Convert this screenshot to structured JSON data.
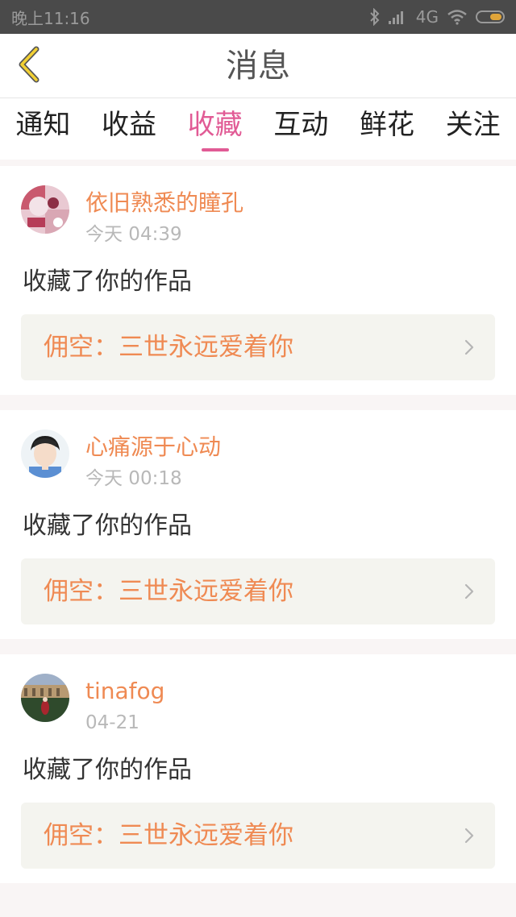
{
  "status_bar": {
    "time": "晚上11:16",
    "network": "4G"
  },
  "header": {
    "title": "消息"
  },
  "tabs": [
    {
      "label": "通知",
      "active": false
    },
    {
      "label": "收益",
      "active": false
    },
    {
      "label": "收藏",
      "active": true
    },
    {
      "label": "互动",
      "active": false
    },
    {
      "label": "鲜花",
      "active": false
    },
    {
      "label": "关注",
      "active": false
    }
  ],
  "colors": {
    "accent_pink": "#e15b95",
    "username_orange": "#ef8a53",
    "status_bar_bg": "#4a4a4a"
  },
  "messages": [
    {
      "username": "依旧熟悉的瞳孔",
      "time": "今天 04:39",
      "action": "收藏了你的作品",
      "work_title": "佣空：三世永远爱着你"
    },
    {
      "username": "心痛源于心动",
      "time": "今天 00:18",
      "action": "收藏了你的作品",
      "work_title": "佣空：三世永远爱着你"
    },
    {
      "username": "tinafog",
      "time": "04-21",
      "action": "收藏了你的作品",
      "work_title": "佣空：三世永远爱着你"
    }
  ]
}
